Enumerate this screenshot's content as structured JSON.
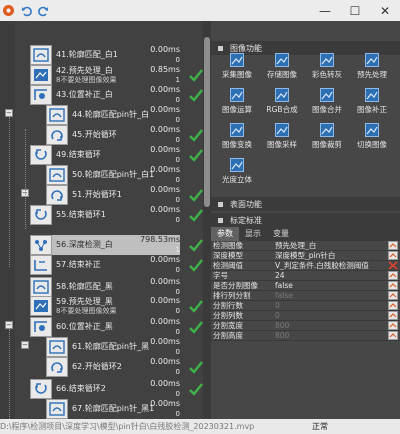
{
  "window": {
    "controls": {
      "minimize": "—",
      "maximize": "☐",
      "close": "✕"
    }
  },
  "flow": {
    "items": [
      {
        "label": "41.轮廓匹配_白1",
        "time": "0.00ms",
        "count": "0",
        "check": false
      },
      {
        "label": "42.预先处理_白",
        "sub": "8不要处理图像效果",
        "time": "0.85ms",
        "count": "1",
        "check": true
      },
      {
        "label": "43.位置补正_白",
        "time": "0.00ms",
        "count": "0",
        "check": true
      },
      {
        "label": "44.轮廓匹配pin针_白",
        "time": "0.00ms",
        "count": "0",
        "check": false
      },
      {
        "label": "45.开始循环",
        "time": "0.00ms",
        "count": "0",
        "check": true
      },
      {
        "label": "49.结束循环",
        "time": "0.00ms",
        "count": "0",
        "check": true
      },
      {
        "label": "50.轮廓匹配pin针_白1",
        "time": "0.00ms",
        "count": "0",
        "check": false
      },
      {
        "label": "51.开始循环1",
        "time": "0.00ms",
        "count": "0",
        "check": true
      },
      {
        "label": "55.结束循环1",
        "time": "0.00ms",
        "count": "0",
        "check": true
      },
      {
        "label": "56.深度检测_白",
        "time": "798.53ms",
        "count": "1",
        "check": true
      },
      {
        "label": "57.结束补正",
        "time": "0.00ms",
        "count": "0",
        "check": true
      },
      {
        "label": "58.轮廓匹配_黑",
        "time": "0.00ms",
        "count": "0",
        "check": false
      },
      {
        "label": "59.预先处理_黑",
        "sub": "8不要处理图像效果",
        "time": "0.00ms",
        "count": "0",
        "check": true
      },
      {
        "label": "60.位置补正_黑",
        "time": "0.00ms",
        "count": "0",
        "check": true
      },
      {
        "label": "61.轮廓匹配pin针_黑",
        "time": "0.00ms",
        "count": "0",
        "check": false
      },
      {
        "label": "62.开始循环2",
        "time": "0.00ms",
        "count": "0",
        "check": true
      },
      {
        "label": "66.结束循环2",
        "time": "0.00ms",
        "count": "0",
        "check": true
      },
      {
        "label": "67.轮廓匹配pin针_黑1",
        "time": "0.00ms",
        "count": "0",
        "check": false
      }
    ]
  },
  "tools": {
    "header": "图像功能",
    "items": [
      "采集图像",
      "存储图像",
      "彩色转灰",
      "预先处理",
      "图像运算",
      "RGB合成",
      "图像合并",
      "图像补正",
      "图像变换",
      "图像采样",
      "图像裁剪",
      "切换图像",
      "光度立体"
    ],
    "sections": [
      "表面功能",
      "标定标准"
    ]
  },
  "params": {
    "tabs": [
      "参数",
      "显示",
      "变量"
    ],
    "rows": [
      {
        "key": "检测图像",
        "value": "预先处理_白",
        "dim": false,
        "btn": "ref"
      },
      {
        "key": "深度模型",
        "value": "深度模型_pin针白",
        "dim": false,
        "btn": "ref"
      },
      {
        "key": "检测阈值",
        "value": "V_判定条件.白残胶检测阈值",
        "dim": false,
        "btn": "close"
      },
      {
        "key": "字号",
        "value": "24",
        "dim": false,
        "btn": "ref"
      },
      {
        "key": "是否分割图像",
        "value": "false",
        "dim": false,
        "btn": "ref"
      },
      {
        "key": "排行列分割",
        "value": "false",
        "dim": true,
        "btn": "ref"
      },
      {
        "key": "分割行数",
        "value": "0",
        "dim": true,
        "btn": "ref"
      },
      {
        "key": "分割列数",
        "value": "0",
        "dim": true,
        "btn": "ref"
      },
      {
        "key": "分割宽度",
        "value": "800",
        "dim": true,
        "btn": "ref"
      },
      {
        "key": "分割高度",
        "value": "800",
        "dim": true,
        "btn": "ref"
      }
    ]
  },
  "status": {
    "path": "D:\\程序\\检测项目\\深度学习\\模型\\pin针白\\白残胶检测_20230321.mvp",
    "state": "正常"
  },
  "colors": {
    "accent": "#e05a1f",
    "check": "#3fb24a",
    "close": "#d8452a",
    "selected": "#bfbfbf"
  }
}
